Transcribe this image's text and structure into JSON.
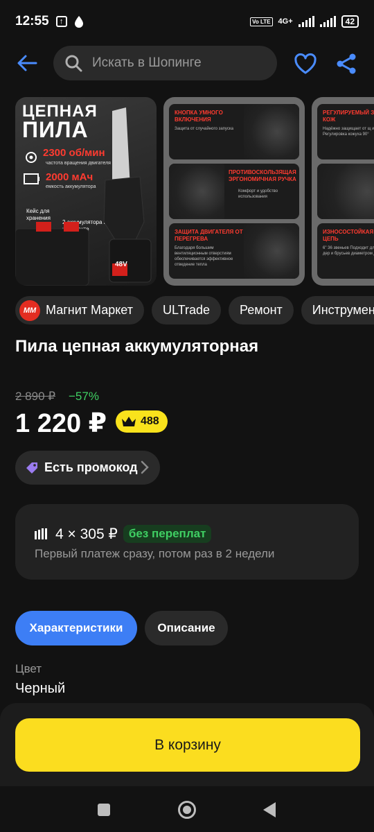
{
  "status_bar": {
    "time": "12:55",
    "network": "4G+",
    "volte": "Vo LTE",
    "battery": "42"
  },
  "search": {
    "placeholder": "Искать в Шопинге"
  },
  "gallery": {
    "slide1": {
      "title_line1": "ЦЕПНАЯ",
      "title_line2": "ПИЛА",
      "stat1_value": "2300 об/мин",
      "stat1_label": "частота вращения двигателя",
      "stat2_value": "2000 мАч",
      "stat2_label": "емкость аккумулятора",
      "note_case": "Кейс для хранения",
      "note_batteries": "2 аккумулятора в комплекте",
      "battery_label": "48V"
    },
    "slide2": {
      "panels": [
        {
          "title": "КНОПКА УМНОГО ВКЛЮЧЕНИЯ",
          "sub": "Защита от случайного запуска"
        },
        {
          "title": "ПРОТИВОСКОЛЬЗЯЩАЯ ЭРГОНОМИЧНАЯ РУЧКА",
          "sub": "Комфорт и удобство использования"
        },
        {
          "title": "ЗАЩИТА ДВИГАТЕЛЯ ОТ ПЕРЕГРЕВА",
          "sub": "Благодаря большим вентиляционным отверстиям обеспечивается эффективное отведение тепла"
        }
      ]
    },
    "slide3": {
      "panels": [
        {
          "title": "РЕГУЛИРУЕМЫЙ ЗАЩИТНЫЙ КОЖ",
          "sub": "Надёжно защищает от щ и опилок Регулировка кожуха 90°"
        },
        {
          "title": "",
          "sub": ""
        },
        {
          "title": "ИЗНОСОСТОЙКАЯ ОСТРАЯ ЦЕПЬ",
          "sub": "6\" 36 звеньев Подходит для дров, дер и брусьев диаметром до"
        }
      ]
    }
  },
  "chips": {
    "shop_logo": "ММ",
    "shop": "Магнит Маркет",
    "brand": "ULTrade",
    "cat1": "Ремонт",
    "cat2": "Инструменты"
  },
  "product": {
    "title": "Пила цепная аккумуляторная",
    "old_price": "2 890 ₽",
    "discount": "−57%",
    "price": "1 220 ₽",
    "bonus": "488",
    "promo": "Есть промокод"
  },
  "installment": {
    "amount": "4 × 305 ₽",
    "badge": "без переплат",
    "description": "Первый платеж сразу, потом раз в 2 недели"
  },
  "tabs": {
    "specs": "Характеристики",
    "description": "Описание"
  },
  "specs": {
    "color_label": "Цвет",
    "color_value": "Черный"
  },
  "cart": {
    "button": "В корзину"
  },
  "colors": {
    "accent_blue": "#3d7ef5",
    "cart_yellow": "#fbdd1f",
    "discount_green": "#3fcf63",
    "bg": "#121212"
  }
}
